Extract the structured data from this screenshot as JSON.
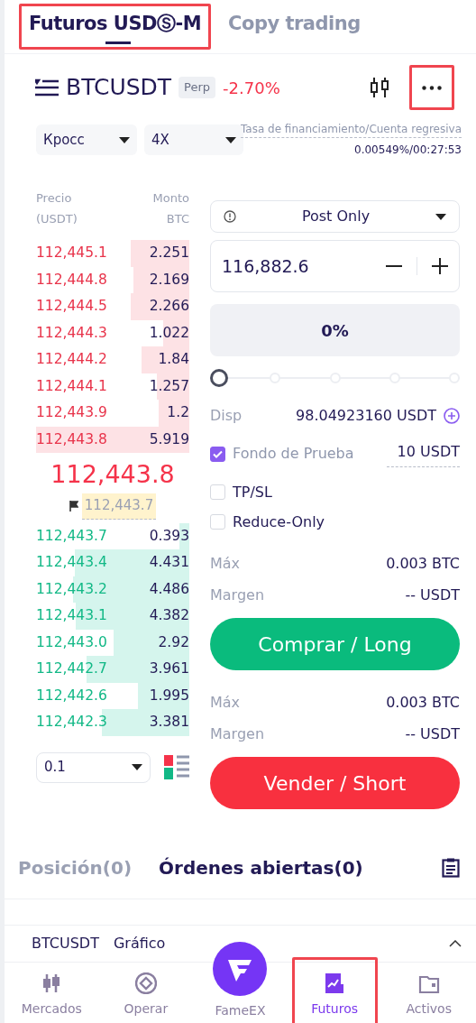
{
  "top_tabs": [
    {
      "label": "Futuros USDⓈ-M",
      "selected": true,
      "highlighted": true
    },
    {
      "label": "Copy trading",
      "selected": false,
      "highlighted": false
    }
  ],
  "symbol": {
    "name": "BTCUSDT",
    "tag": "Perp",
    "change": "-2.70%",
    "more_highlighted": true
  },
  "margin_mode": "Кросс",
  "leverage": "4X",
  "funding": {
    "label": "Tasa de financiamiento/Cuenta regresiva",
    "value": "0.00549%/00:27:53"
  },
  "orderbook": {
    "price_header": [
      "Precio",
      "(USDT)"
    ],
    "amount_header": [
      "Monto",
      "BTC"
    ],
    "asks": [
      {
        "price": "112,445.1",
        "amount": "2.251"
      },
      {
        "price": "112,444.8",
        "amount": "2.169"
      },
      {
        "price": "112,444.5",
        "amount": "2.266"
      },
      {
        "price": "112,444.3",
        "amount": "1.022"
      },
      {
        "price": "112,444.2",
        "amount": "1.84"
      },
      {
        "price": "112,444.1",
        "amount": "1.257"
      },
      {
        "price": "112,443.9",
        "amount": "1.2"
      },
      {
        "price": "112,443.8",
        "amount": "5.919"
      }
    ],
    "last_price": "112,443.8",
    "mark_price": "112,443.7",
    "bids": [
      {
        "price": "112,443.7",
        "amount": "0.393"
      },
      {
        "price": "112,443.4",
        "amount": "4.431"
      },
      {
        "price": "112,443.2",
        "amount": "4.486"
      },
      {
        "price": "112,443.1",
        "amount": "4.382"
      },
      {
        "price": "112,443.0",
        "amount": "2.92"
      },
      {
        "price": "112,442.7",
        "amount": "3.961"
      },
      {
        "price": "112,442.6",
        "amount": "1.995"
      },
      {
        "price": "112,442.3",
        "amount": "3.381"
      }
    ],
    "precision": "0.1"
  },
  "order_form": {
    "order_type": "Post Only",
    "price": "116,882.6",
    "amount": "0%",
    "slider": {
      "level": 0
    },
    "available_label": "Disp",
    "available": "98.04923160 USDT",
    "options": [
      {
        "label": "Fondo de Prueba",
        "checked": true,
        "value": "10 USDT"
      },
      {
        "label": "TP/SL",
        "checked": false
      },
      {
        "label": "Reduce-Only",
        "checked": false
      }
    ],
    "sides": [
      {
        "kind": "buy",
        "max_label": "Máx",
        "max": "0.003 BTC",
        "margin_label": "Margen",
        "margin": "-- USDT",
        "button": "Comprar / Long"
      },
      {
        "kind": "sell",
        "max_label": "Máx",
        "max": "0.003 BTC",
        "margin_label": "Margen",
        "margin": "-- USDT",
        "button": "Vender / Short"
      }
    ]
  },
  "bottom_tabs": [
    {
      "label": "Posición(0)",
      "selected": false
    },
    {
      "label": "Órdenes abiertas(0)",
      "selected": true
    }
  ],
  "chart_bar": {
    "symbol": "BTCUSDT",
    "label": "Gráfico"
  },
  "nav": [
    {
      "label": "Mercados",
      "kind": "candles",
      "selected": false,
      "highlighted": false
    },
    {
      "label": "Operar",
      "kind": "trade",
      "selected": false,
      "highlighted": false
    },
    {
      "label": "FameEX",
      "kind": "logo",
      "selected": false,
      "highlighted": false
    },
    {
      "label": "Futuros",
      "kind": "futures",
      "selected": true,
      "highlighted": true
    },
    {
      "label": "Activos",
      "kind": "wallet",
      "selected": false,
      "highlighted": false
    }
  ]
}
